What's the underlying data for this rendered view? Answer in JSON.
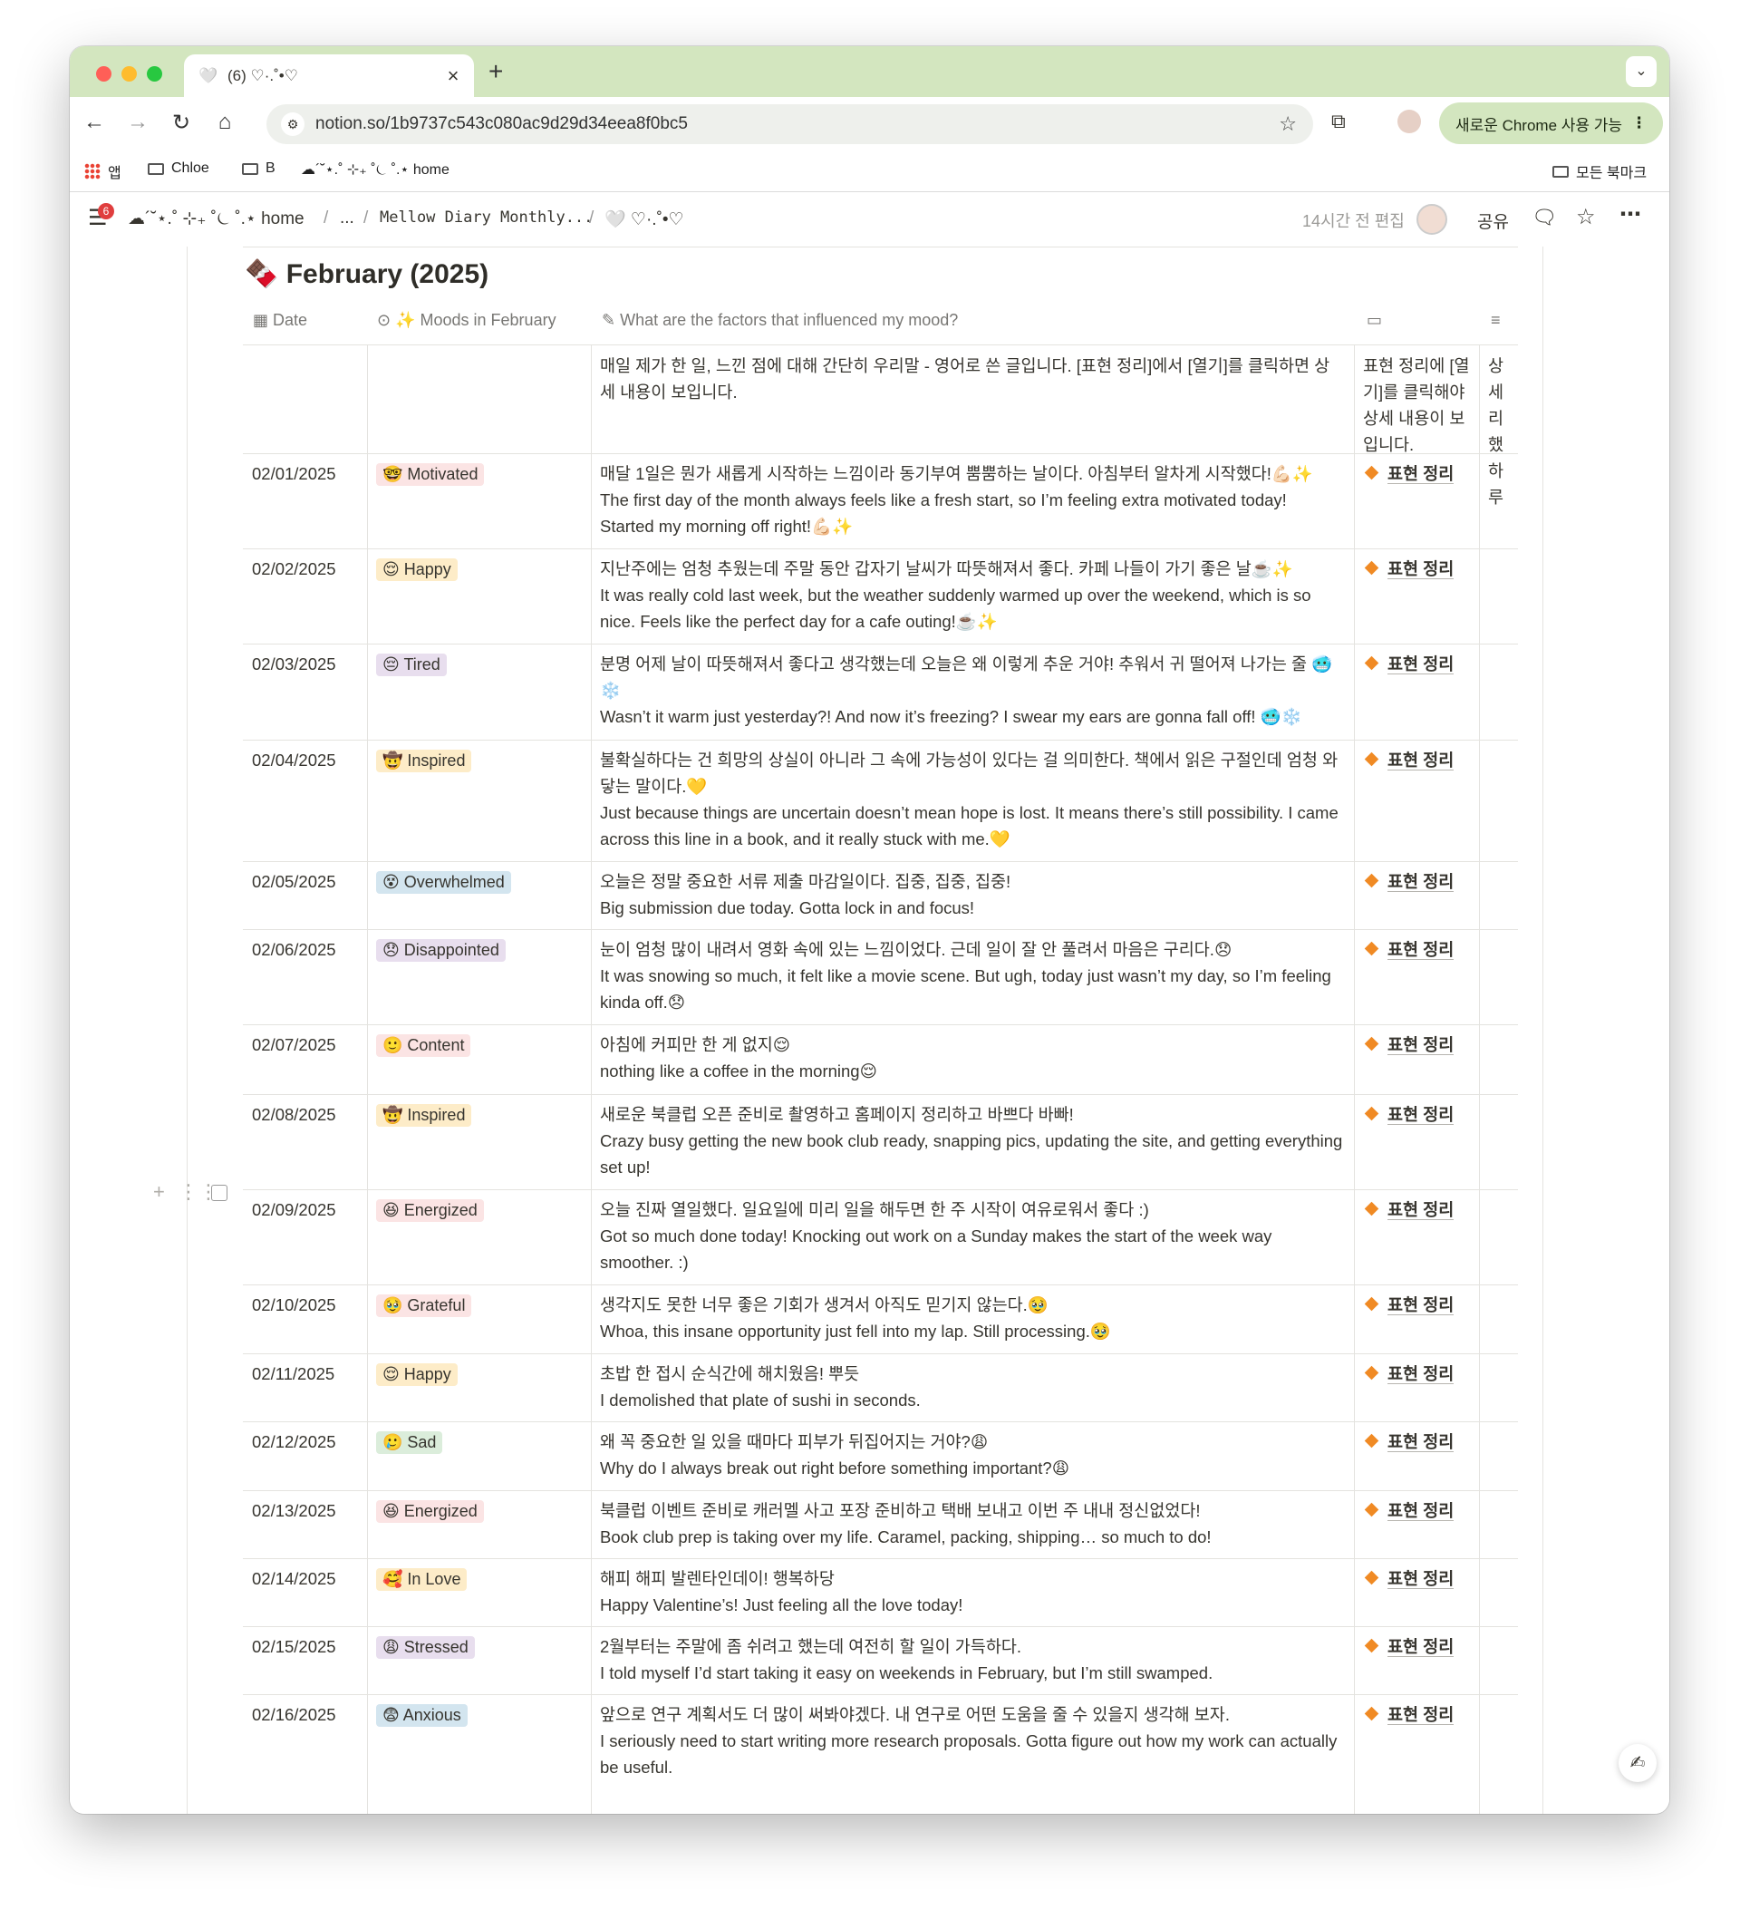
{
  "browser": {
    "tab_title": "(6) ♡·.˚•♡",
    "tab_icon": "heart-icon",
    "url": "notion.so/1b9737c543c080ac9d29d34eea8f0bc5",
    "chrome_button": "새로운 Chrome 사용 가능",
    "bookmarks": [
      "앱",
      "Chloe",
      "B",
      "☁︎´˘⋆.˚ ⊹₊ ˚⏾ ˚.⋆ home"
    ],
    "all_bookmarks": "모든 북마크",
    "colors": {
      "accent": "#d3e6bf"
    }
  },
  "notion": {
    "notification_count": "6",
    "breadcrumb": [
      "☁︎´˘⋆.˚ ⊹₊ ˚⏾ ˚.⋆ home",
      "...",
      "Mellow Diary Monthly...",
      "🤍 ♡·.˚•♡"
    ],
    "edited": "14시간 전 편집",
    "share": "공유"
  },
  "database": {
    "title": "February (2025)",
    "title_icon": "chocolate-icon",
    "columns": [
      "Date",
      "✨ Moods in February",
      "What are the factors that influenced my mood?",
      "",
      ""
    ],
    "intro_row": {
      "text": "매일 제가 한 일, 느낀 점에 대해 간단히 우리말 - 영어로 쓴 글입니다. [표현 정리]에서 [열기]를 클릭하면 상세 내용이 보입니다.",
      "expr": "표현 정리에 [열기]를 클릭해야 상세 내용이 보입니다.",
      "detail": "상세 리했 하루"
    },
    "expression_label": "표현 정리",
    "rows": [
      {
        "date": "02/01/2025",
        "mood": "🤓 Motivated",
        "mood_color": "#fbe4e4",
        "kr": "매달 1일은 뭔가 새롭게 시작하는 느낌이라 동기부여 뿜뿜하는 날이다. 아침부터 알차게 시작했다!💪🏻✨",
        "en": "The first day of the month always feels like a fresh start, so I’m feeling extra motivated today! Started my morning off right!💪🏻✨"
      },
      {
        "date": "02/02/2025",
        "mood": "😌 Happy",
        "mood_color": "#fdecc8",
        "kr": "지난주에는 엄청 추웠는데 주말 동안 갑자기 날씨가 따뜻해져서 좋다. 카페 나들이 가기 좋은 날☕️✨",
        "en": "It was really cold last week, but the weather suddenly warmed up over the weekend, which is so nice. Feels like the perfect day for a cafe outing!☕️✨"
      },
      {
        "date": "02/03/2025",
        "mood": "😔 Tired",
        "mood_color": "#e8deee",
        "kr": "분명 어제 날이 따뜻해져서 좋다고 생각했는데 오늘은 왜 이렇게 추운 거야! 추워서 귀 떨어져 나가는 줄 🥶❄️",
        "en": "Wasn’t it warm just yesterday?! And now it’s freezing? I swear my ears are gonna fall off! 🥶❄️"
      },
      {
        "date": "02/04/2025",
        "mood": "🤠 Inspired",
        "mood_color": "#fdecc8",
        "kr": "불확실하다는 건 희망의 상실이 아니라 그 속에 가능성이 있다는 걸 의미한다. 책에서 읽은 구절인데 엄청 와닿는 말이다.💛",
        "en": "Just because things are uncertain doesn’t mean hope is lost. It means there’s still possibility. I came across this line in a book, and it really stuck with me.💛"
      },
      {
        "date": "02/05/2025",
        "mood": "😵 Overwhelmed",
        "mood_color": "#d3e5ef",
        "kr": "오늘은 정말 중요한 서류 제출 마감일이다. 집중, 집중, 집중!",
        "en": "Big submission due today. Gotta lock in and focus!"
      },
      {
        "date": "02/06/2025",
        "mood": "😞 Disappointed",
        "mood_color": "#e8deee",
        "kr": "눈이 엄청 많이 내려서 영화 속에 있는 느낌이었다. 근데 일이 잘 안 풀려서 마음은 구리다.😞",
        "en": "It was snowing so much, it felt like a movie scene. But ugh, today just wasn’t my day, so I’m feeling kinda off.😞"
      },
      {
        "date": "02/07/2025",
        "mood": "🙂 Content",
        "mood_color": "#fbe4e4",
        "kr": "아침에 커피만 한 게 없지😌",
        "en": "nothing like a coffee in the morning😌"
      },
      {
        "date": "02/08/2025",
        "mood": "🤠 Inspired",
        "mood_color": "#fdecc8",
        "kr": "새로운 북클럽 오픈 준비로 촬영하고 홈페이지 정리하고 바쁘다 바빠!",
        "en": "Crazy busy getting the new book club ready, snapping pics, updating the site, and getting everything set up!"
      },
      {
        "date": "02/09/2025",
        "mood": "😆 Energized",
        "mood_color": "#fbe4e4",
        "kr": "오늘 진짜 열일했다. 일요일에 미리 일을 해두면 한 주 시작이 여유로워서 좋다 :)",
        "en": "Got so much done today! Knocking out work on a Sunday makes the start of the week way smoother. :)"
      },
      {
        "date": "02/10/2025",
        "mood": "🥹 Grateful",
        "mood_color": "#fbe4e4",
        "kr": "생각지도 못한 너무 좋은 기회가 생겨서 아직도 믿기지 않는다.🥹",
        "en": "Whoa, this insane opportunity just fell into my lap. Still processing.🥹"
      },
      {
        "date": "02/11/2025",
        "mood": "😌 Happy",
        "mood_color": "#fdecc8",
        "kr": "초밥 한 접시 순식간에 해치웠음! 뿌듯",
        "en": "I demolished that plate of sushi in seconds."
      },
      {
        "date": "02/12/2025",
        "mood": "🥲 Sad",
        "mood_color": "#dbeddb",
        "kr": "왜 꼭 중요한 일 있을 때마다 피부가 뒤집어지는 거야?😩",
        "en": "Why do I always break out right before something important?😩"
      },
      {
        "date": "02/13/2025",
        "mood": "😆 Energized",
        "mood_color": "#fbe4e4",
        "kr": "북클럽 이벤트 준비로 캐러멜 사고 포장 준비하고 택배 보내고 이번 주 내내 정신없었다!",
        "en": "Book club prep is taking over my life. Caramel, packing, shipping… so much to do!"
      },
      {
        "date": "02/14/2025",
        "mood": "🥰 In Love",
        "mood_color": "#fdecc8",
        "kr": "해피 해피 발렌타인데이! 행복하당",
        "en": "Happy Valentine’s! Just feeling all the love today!"
      },
      {
        "date": "02/15/2025",
        "mood": "😩 Stressed",
        "mood_color": "#e8deee",
        "kr": "2월부터는 주말에 좀 쉬려고 했는데 여전히 할 일이 가득하다.",
        "en": "I told myself I’d start taking it easy on weekends in February, but I’m still swamped."
      },
      {
        "date": "02/16/2025",
        "mood": "😨 Anxious",
        "mood_color": "#d3e5ef",
        "kr": "앞으로 연구 계획서도 더 많이 써봐야겠다. 내 연구로 어떤 도움을 줄 수 있을지 생각해 보자.",
        "en": "I seriously need to start writing more research proposals. Gotta figure out how my work can actually be useful."
      }
    ]
  }
}
